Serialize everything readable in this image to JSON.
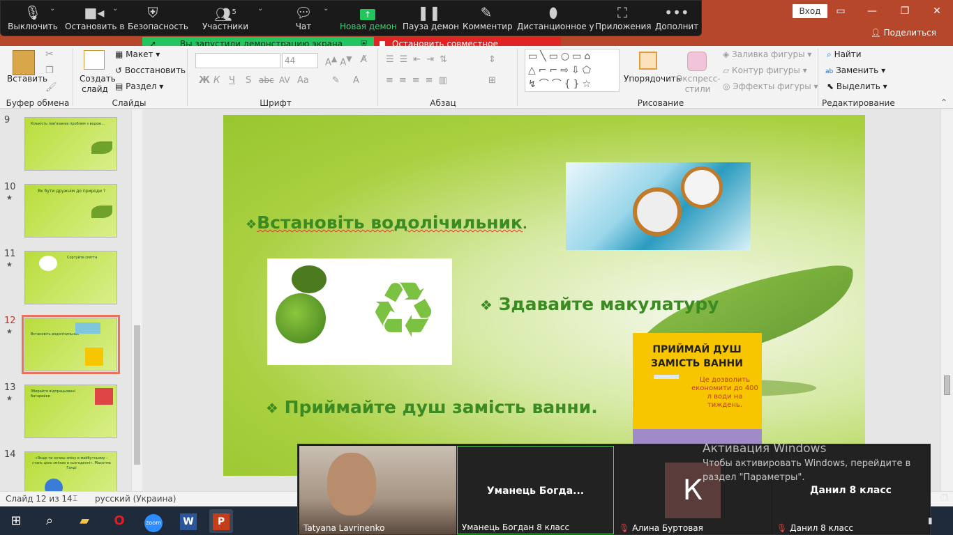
{
  "titlebar": {
    "login_label": "Вход",
    "share_label": "Поделиться",
    "min_icon": "minimize-icon",
    "restore_icon": "restore-icon",
    "close_icon": "close-icon"
  },
  "zoom_toolbar": {
    "items": [
      {
        "label": "Выключить",
        "icon": "microphone-icon"
      },
      {
        "label": "Остановить в",
        "icon": "video-camera-icon"
      },
      {
        "label": "Безопасность",
        "icon": "shield-icon"
      },
      {
        "label": "Участники",
        "icon": "participants-icon",
        "badge": "5"
      },
      {
        "label": "Чат",
        "icon": "chat-icon"
      },
      {
        "label": "Новая демон",
        "icon": "share-screen-icon"
      },
      {
        "label": "Пауза демон",
        "icon": "pause-icon"
      },
      {
        "label": "Комментир",
        "icon": "pen-icon"
      },
      {
        "label": "Дистанционное у",
        "icon": "mouse-icon"
      },
      {
        "label": "Приложения",
        "icon": "apps-icon"
      },
      {
        "label": "Дополнит",
        "icon": "more-icon"
      }
    ]
  },
  "share_banner": {
    "sharing_text": "Вы запустили демонстрацию экрана",
    "stop_text": "Остановить совместное использование"
  },
  "ribbon": {
    "clipboard": {
      "paste": "Вставить",
      "group": "Буфер обмена"
    },
    "slides": {
      "new_slide": "Создать слайд",
      "layout": "Макет",
      "reset": "Восстановить",
      "section": "Раздел",
      "group": "Слайды"
    },
    "font": {
      "size": "44",
      "group": "Шрифт",
      "bold": "Ж",
      "italic": "К",
      "underline": "Ч",
      "strike": "S",
      "shadow": "abc",
      "spacing": "AV",
      "case": "Aa"
    },
    "paragraph": {
      "group": "Абзац"
    },
    "drawing": {
      "arrange": "Упорядочить",
      "styles": "Экспресс-стили",
      "fill": "Заливка фигуры",
      "outline": "Контур фигуры",
      "effects": "Эффекты фигуры",
      "group": "Рисование"
    },
    "editing": {
      "find": "Найти",
      "replace": "Заменить",
      "select": "Выделить",
      "group": "Редактирование"
    }
  },
  "thumbnails": [
    {
      "num": "9",
      "star": false,
      "title": "Кількість пов'язаних проблем з водою..."
    },
    {
      "num": "10",
      "star": true,
      "title": "Як бути дружнім до природи ?"
    },
    {
      "num": "11",
      "star": true,
      "title": "Сортуйте сміття"
    },
    {
      "num": "12",
      "star": true,
      "title": "Встановіть водолічильник",
      "selected": true
    },
    {
      "num": "13",
      "star": true,
      "title": "Збирайте відпрацьовані батарейки"
    },
    {
      "num": "14",
      "star": false,
      "title": "«Якщо ти хочеш зміну в майбутньому – стань цією зміною в сьогоденні». Махатма Ганді"
    }
  ],
  "slide": {
    "line1": "Встановіть водолічильник",
    "line1_suffix": ".",
    "line2": "Здавайте макулатуру",
    "line3": "Приймайте душ замість ванни.",
    "bullet": "❖",
    "poster": {
      "title": "ПРИЙМАЙ ДУШ ЗАМІСТЬ ВАННИ",
      "note": "Це дозволить економити до 400 л води на тиждень."
    }
  },
  "status": {
    "slide_pos": "Слайд 12 из 14",
    "language": "русский (Украина)"
  },
  "video_tiles": [
    {
      "name": "Tatyana Lavrinenko",
      "has_video": true,
      "muted": false
    },
    {
      "name": "Уманець Богдан 8 класс",
      "big": "Уманець  Богда...",
      "muted": false,
      "active": true
    },
    {
      "name": "Алина Буртовая",
      "avatar": "К",
      "muted": true
    },
    {
      "name": "Данил 8 класс",
      "big": "Данил 8 класс",
      "muted": true
    }
  ],
  "activation": {
    "title": "Активация Windows",
    "text": "Чтобы активировать Windows, перейдите в раздел \"Параметры\"."
  },
  "colors": {
    "powerpoint_red": "#b7472a",
    "zoom_green": "#23c55e",
    "zoom_red": "#e02424",
    "slide_green_text": "#3b8a22"
  }
}
